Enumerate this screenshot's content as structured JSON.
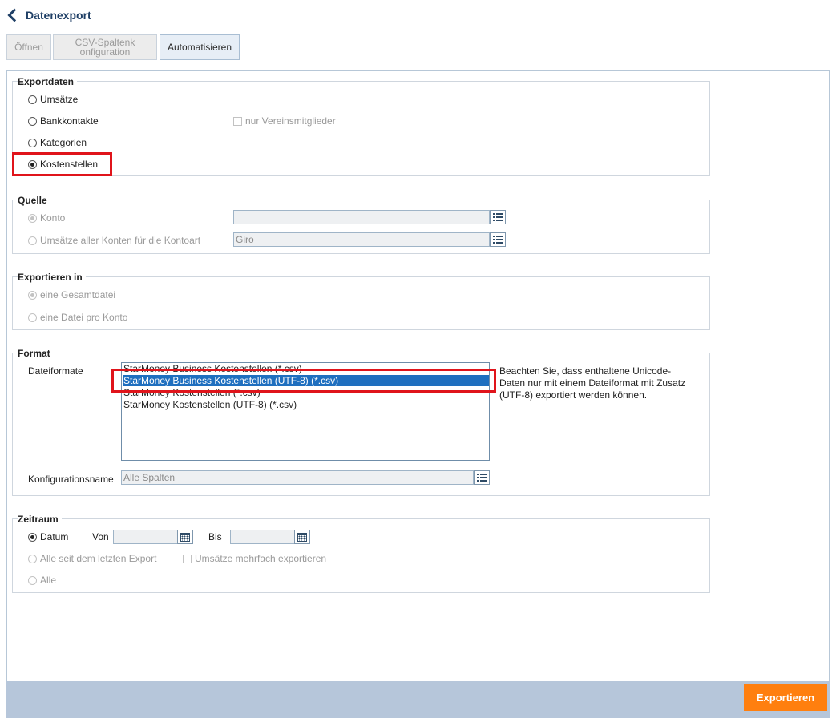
{
  "header": {
    "title": "Datenexport"
  },
  "tabs": [
    {
      "label": "Öffnen"
    },
    {
      "label": "CSV-Spaltenkonfiguration"
    },
    {
      "label": "Automatisieren"
    }
  ],
  "exportdaten": {
    "legend": "Exportdaten",
    "options": [
      "Umsätze",
      "Bankkontakte",
      "Kategorien",
      "Kostenstellen"
    ],
    "selected": "Kostenstellen",
    "checkbox_label": "nur Vereinsmitglieder"
  },
  "quelle": {
    "legend": "Quelle",
    "konto_label": "Konto",
    "konto_value": "",
    "kontoart_label": "Umsätze aller Konten für die Kontoart",
    "kontoart_value": "Giro"
  },
  "exportieren_in": {
    "legend": "Exportieren in",
    "options": [
      "eine Gesamtdatei",
      "eine Datei pro Konto"
    ]
  },
  "format": {
    "legend": "Format",
    "dateiformate_label": "Dateiformate",
    "formats": [
      "StarMoney Business Kostenstellen (*.csv)",
      "StarMoney Business Kostenstellen (UTF-8) (*.csv)",
      "StarMoney Kostenstellen (*.csv)",
      "StarMoney Kostenstellen (UTF-8) (*.csv)"
    ],
    "selected_index": 1,
    "note": "Beachten Sie, dass enthaltene Unicode-Daten nur mit einem Dateiformat mit Zusatz (UTF-8) exportiert werden können.",
    "konfig_label": "Konfigurationsname",
    "konfig_value": "Alle Spalten"
  },
  "zeitraum": {
    "legend": "Zeitraum",
    "datum_label": "Datum",
    "von_label": "Von",
    "von_value": "",
    "bis_label": "Bis",
    "bis_value": "",
    "seit_label": "Alle seit dem letzten Export",
    "mehrfach_label": "Umsätze mehrfach exportieren",
    "alle_label": "Alle"
  },
  "footer": {
    "export_button": "Exportieren"
  },
  "colors": {
    "accent": "#ff7f0f",
    "selection": "#1f6fbf",
    "highlight": "#e0141b",
    "title": "#1f3f66"
  }
}
